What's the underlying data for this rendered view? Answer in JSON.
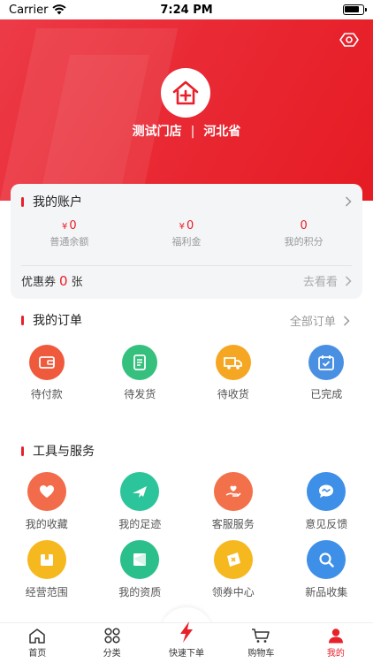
{
  "status_bar": {
    "carrier": "Carrier",
    "time": "7:24 PM"
  },
  "hero": {
    "store_name": "测试门店",
    "separator": "|",
    "region": "河北省",
    "eye_icon": "eye-icon",
    "logo_icon": "store-logo-icon"
  },
  "account": {
    "title": "我的账户",
    "stats": [
      {
        "symbol": "¥",
        "value": "0",
        "label": "普通余额"
      },
      {
        "symbol": "¥",
        "value": "0",
        "label": "福利金"
      },
      {
        "symbol": "",
        "value": "0",
        "label": "我的积分"
      }
    ],
    "coupon": {
      "label": "优惠券",
      "count": "0",
      "unit": "张",
      "link": "去看看"
    }
  },
  "orders": {
    "title": "我的订单",
    "link": "全部订单",
    "items": [
      {
        "label": "待付款",
        "icon": "wallet-icon",
        "color": "#f05a3c"
      },
      {
        "label": "待发货",
        "icon": "document-icon",
        "color": "#36c07e"
      },
      {
        "label": "待收货",
        "icon": "truck-icon",
        "color": "#f5a623"
      },
      {
        "label": "已完成",
        "icon": "calendar-check-icon",
        "color": "#4a90e2"
      }
    ]
  },
  "tools": {
    "title": "工具与服务",
    "items": [
      {
        "label": "我的收藏",
        "icon": "heart-icon",
        "color": "#f26b4a"
      },
      {
        "label": "我的足迹",
        "icon": "plane-icon",
        "color": "#2cc49a"
      },
      {
        "label": "客服服务",
        "icon": "service-hand-icon",
        "color": "#f2704a"
      },
      {
        "label": "意见反馈",
        "icon": "chat-bubble-icon",
        "color": "#3d8fe8"
      },
      {
        "label": "经营范围",
        "icon": "box-icon",
        "color": "#f6b81f"
      },
      {
        "label": "我的资质",
        "icon": "certificate-icon",
        "color": "#2bbf8c"
      },
      {
        "label": "领券中心",
        "icon": "coupon-icon",
        "color": "#f6b81f"
      },
      {
        "label": "新品收集",
        "icon": "search-icon",
        "color": "#3d8fe8"
      }
    ]
  },
  "tabbar": {
    "items": [
      {
        "label": "首页",
        "icon": "home-icon"
      },
      {
        "label": "分类",
        "icon": "grid-icon"
      },
      {
        "label": "快速下单",
        "icon": "lightning-icon"
      },
      {
        "label": "购物车",
        "icon": "cart-icon"
      },
      {
        "label": "我的",
        "icon": "user-icon",
        "active": true
      }
    ]
  },
  "colors": {
    "brand_red": "#e8202a",
    "card_bg": "#f4f5f7"
  }
}
